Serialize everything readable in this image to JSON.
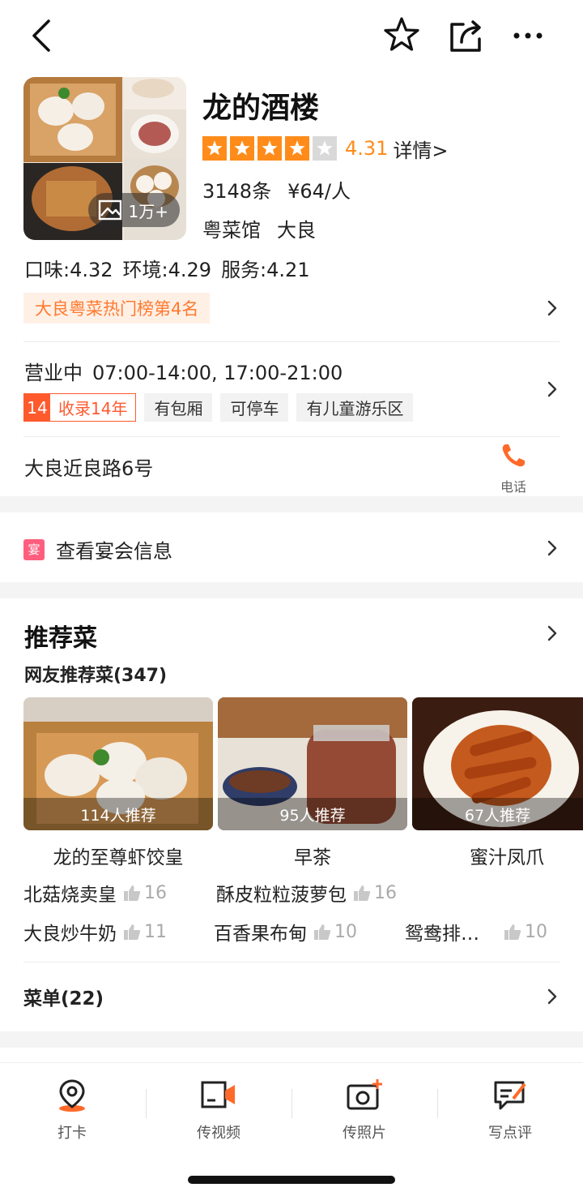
{
  "header": {
    "back_icon": "back-arrow-icon",
    "favorite_icon": "star-outline-icon",
    "share_icon": "share-icon",
    "more_icon": "more-dots-icon"
  },
  "restaurant": {
    "name": "龙的酒楼",
    "photo_count": "1万+",
    "rating_stars": 4,
    "rating_score": "4.31",
    "detail_label": "详情>",
    "review_count": "3148条",
    "price_per_person": "¥64/人",
    "category": "粤菜馆",
    "area": "大良",
    "scores": {
      "taste": "口味:4.32",
      "environment": "环境:4.29",
      "service": "服务:4.21"
    },
    "rank_badge": "大良粤菜热门榜第4名",
    "status": "营业中",
    "hours": "07:00-14:00, 17:00-21:00",
    "years_num": "14",
    "years_label": "收录14年",
    "tags": [
      "有包厢",
      "可停车",
      "有儿童游乐区"
    ],
    "address": "大良近良路6号",
    "phone_label": "电话"
  },
  "banquet": {
    "icon_text": "宴",
    "label": "查看宴会信息"
  },
  "recommend": {
    "title": "推荐菜",
    "subtitle": "网友推荐菜(347)",
    "dishes": [
      {
        "name": "龙的至尊虾饺皇",
        "recommend": "114人推荐"
      },
      {
        "name": "早茶",
        "recommend": "95人推荐"
      },
      {
        "name": "蜜汁凤爪",
        "recommend": "67人推荐"
      }
    ],
    "popular": [
      {
        "name": "北菇烧卖皇",
        "likes": "16"
      },
      {
        "name": "酥皮粒粒菠萝包",
        "likes": "16"
      },
      {
        "name": "大良炒牛奶",
        "likes": "11"
      },
      {
        "name": "百香果布甸",
        "likes": "10"
      },
      {
        "name": "鸳鸯排…",
        "likes": "10"
      }
    ],
    "menu_label": "菜单(22)"
  },
  "bottom_bar": {
    "items": [
      {
        "label": "打卡",
        "icon": "location-pin-icon"
      },
      {
        "label": "传视频",
        "icon": "video-upload-icon"
      },
      {
        "label": "传照片",
        "icon": "camera-plus-icon"
      },
      {
        "label": "写点评",
        "icon": "write-review-icon"
      }
    ]
  },
  "colors": {
    "accent_orange": "#ff8c1a",
    "tag_red": "#ff5a2e",
    "banquet_pink": "#ff5e7e"
  }
}
